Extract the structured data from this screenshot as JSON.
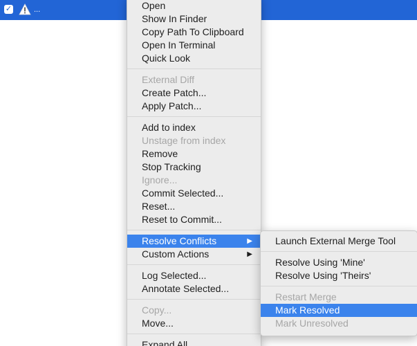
{
  "file_row": {
    "checkbox_mark": "✓",
    "filename": "...",
    "warning_icon": "warning-triangle-icon"
  },
  "context_menu": {
    "groups": [
      [
        "Open",
        "Show In Finder",
        "Copy Path To Clipboard",
        "Open In Terminal",
        "Quick Look"
      ],
      [
        "External Diff",
        "Create Patch...",
        "Apply Patch..."
      ],
      [
        "Add to index",
        "Unstage from index",
        "Remove",
        "Stop Tracking",
        "Ignore...",
        "Commit Selected...",
        "Reset...",
        "Reset to Commit..."
      ],
      [
        "Resolve Conflicts",
        "Custom Actions"
      ],
      [
        "Log Selected...",
        "Annotate Selected..."
      ],
      [
        "Copy...",
        "Move..."
      ],
      [
        "Expand All"
      ]
    ],
    "disabled_items": [
      "External Diff",
      "Unstage from index",
      "Ignore...",
      "Copy..."
    ],
    "highlighted_item": "Resolve Conflicts",
    "submenu_items": [
      "Resolve Conflicts",
      "Custom Actions"
    ]
  },
  "submenu": {
    "groups": [
      [
        "Launch External Merge Tool"
      ],
      [
        "Resolve Using 'Mine'",
        "Resolve Using 'Theirs'"
      ],
      [
        "Restart Merge",
        "Mark Resolved",
        "Mark Unresolved"
      ]
    ],
    "disabled_items": [
      "Restart Merge",
      "Mark Unresolved"
    ],
    "highlighted_item": "Mark Resolved"
  },
  "colors": {
    "selection": "#3b83ec",
    "row_selection": "#2265d6",
    "menu_background": "#ececec",
    "disabled_text": "#a6a6a6"
  }
}
